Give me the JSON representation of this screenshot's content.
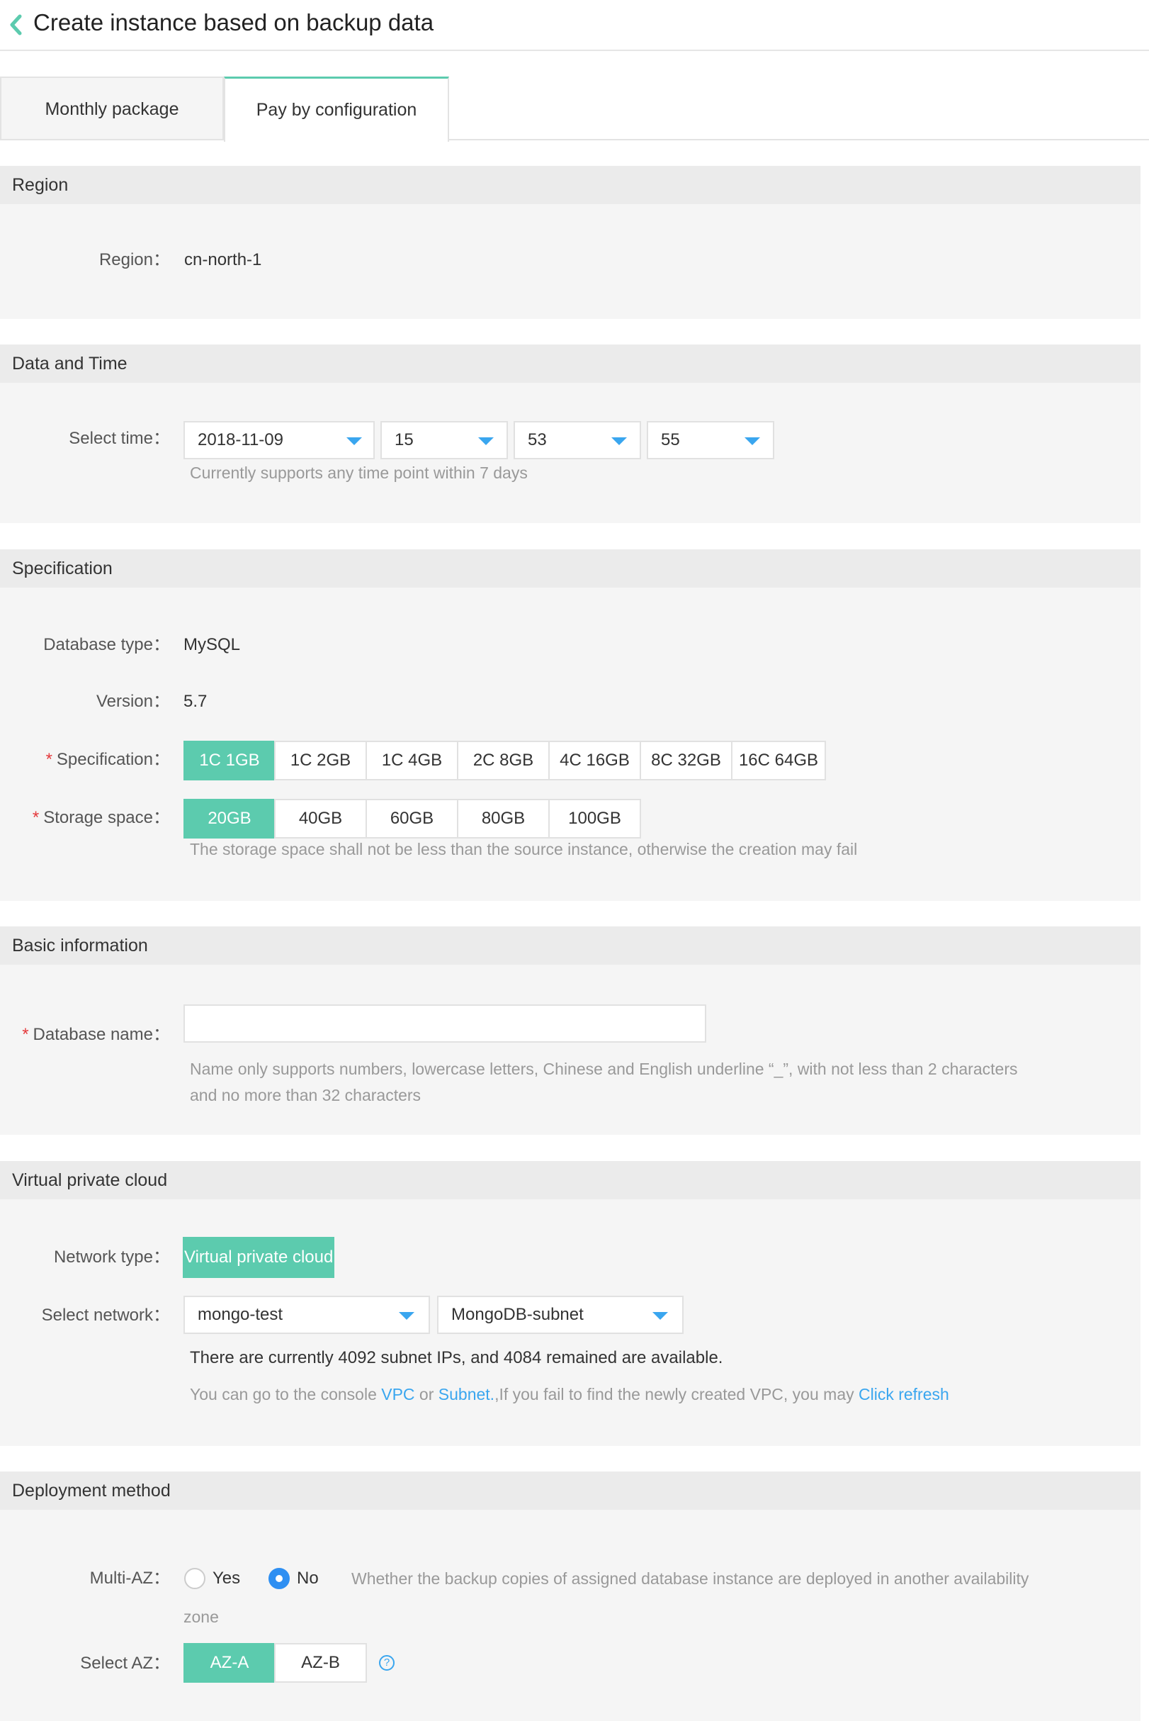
{
  "header": {
    "title": "Create instance based on backup data"
  },
  "tabs": [
    {
      "label": "Monthly package",
      "active": false
    },
    {
      "label": "Pay by configuration",
      "active": true
    }
  ],
  "region": {
    "title": "Region",
    "label": "Region：",
    "value": "cn-north-1"
  },
  "datetime": {
    "title": "Data and Time",
    "label": "Select time：",
    "date": "2018-11-09",
    "hour": "15",
    "minute": "53",
    "second": "55",
    "hint": "Currently supports any time point within 7 days"
  },
  "spec": {
    "title": "Specification",
    "db_type_label": "Database type：",
    "db_type": "MySQL",
    "version_label": "Version：",
    "version": "5.7",
    "spec_label": "Specification：",
    "spec_options": [
      "1C 1GB",
      "1C 2GB",
      "1C 4GB",
      "2C 8GB",
      "4C 16GB",
      "8C 32GB",
      "16C 64GB"
    ],
    "spec_selected": "1C 1GB",
    "storage_label": "Storage space：",
    "storage_options": [
      "20GB",
      "40GB",
      "60GB",
      "80GB",
      "100GB"
    ],
    "storage_selected": "20GB",
    "storage_hint": "The storage space shall not be less than the source instance, otherwise the creation may fail",
    "required_mark": "*"
  },
  "basic": {
    "title": "Basic information",
    "name_label": "Database name：",
    "name_value": "",
    "name_hint_1": "Name only supports numbers, lowercase letters, Chinese and English underline “_”, with not less than 2 characters",
    "name_hint_2": "and no more than 32 characters"
  },
  "vpc": {
    "title": "Virtual private cloud",
    "network_type_label": "Network type：",
    "network_type": "Virtual private cloud",
    "select_network_label": "Select network：",
    "vpc_value": "mongo-test",
    "subnet_value": "MongoDB-subnet",
    "ip_info": "There are currently 4092 subnet IPs, and 4084 remained are available.",
    "console_prefix": "You can go to the console ",
    "vpc_link": "VPC",
    "or": " or ",
    "subnet_link": "Subnet.",
    "console_suffix": ",If you fail to find the newly created VPC, you may ",
    "refresh_link": "Click refresh"
  },
  "deploy": {
    "title": "Deployment method",
    "multi_az_label": "Multi-AZ：",
    "yes": "Yes",
    "no": "No",
    "multi_az_selected": "No",
    "multi_az_hint_1": "Whether the backup copies of assigned database instance are deployed in another availability",
    "multi_az_hint_2": "zone",
    "az_label": "Select AZ：",
    "az_options": [
      "AZ-A",
      "AZ-B"
    ],
    "az_selected": "AZ-A",
    "help_glyph": "?"
  },
  "colors": {
    "accent": "#5ccbae",
    "link": "#3aa6ef",
    "required": "#e4393c"
  }
}
